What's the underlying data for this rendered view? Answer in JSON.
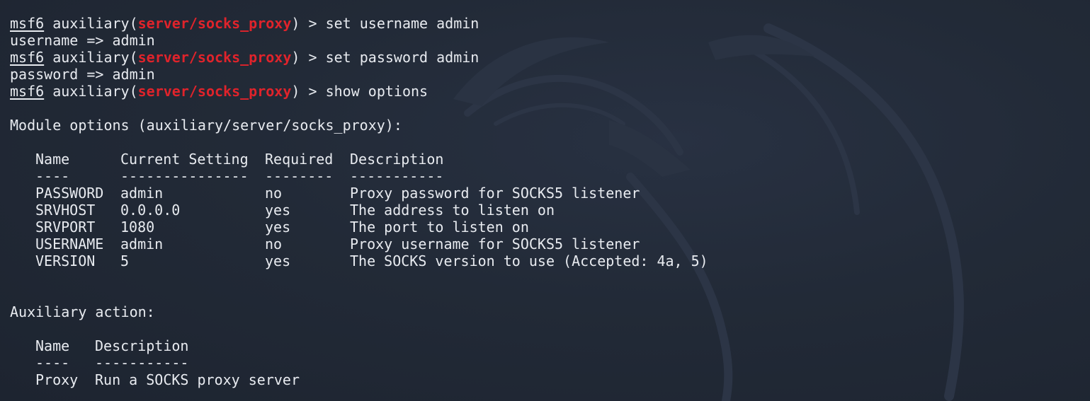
{
  "prompt": {
    "framework": "msf6",
    "type": "auxiliary",
    "module": "server/socks_proxy",
    "suffix": "> "
  },
  "session": [
    {
      "command": "set username admin",
      "output": "username => admin"
    },
    {
      "command": "set password admin",
      "output": "password => admin"
    },
    {
      "command": "show options"
    }
  ],
  "module_options": {
    "title": "Module options (auxiliary/server/socks_proxy):",
    "columns": [
      "Name",
      "Current Setting",
      "Required",
      "Description"
    ],
    "separators": [
      "----",
      "---------------",
      "--------",
      "-----------"
    ],
    "rows": [
      {
        "name": "PASSWORD",
        "setting": "admin",
        "required": "no",
        "description": "Proxy password for SOCKS5 listener"
      },
      {
        "name": "SRVHOST",
        "setting": "0.0.0.0",
        "required": "yes",
        "description": "The address to listen on"
      },
      {
        "name": "SRVPORT",
        "setting": "1080",
        "required": "yes",
        "description": "The port to listen on"
      },
      {
        "name": "USERNAME",
        "setting": "admin",
        "required": "no",
        "description": "Proxy username for SOCKS5 listener"
      },
      {
        "name": "VERSION",
        "setting": "5",
        "required": "yes",
        "description": "The SOCKS version to use (Accepted: 4a, 5)"
      }
    ]
  },
  "auxiliary_action": {
    "title": "Auxiliary action:",
    "columns": [
      "Name",
      "Description"
    ],
    "separators": [
      "----",
      "-----------"
    ],
    "rows": [
      {
        "name": "Proxy",
        "description": "Run a SOCKS proxy server"
      }
    ]
  },
  "colors": {
    "background": "#202734",
    "text": "#e8ebf0",
    "module": "#e0232b"
  },
  "watermark_icon": "kali-dragon-icon"
}
